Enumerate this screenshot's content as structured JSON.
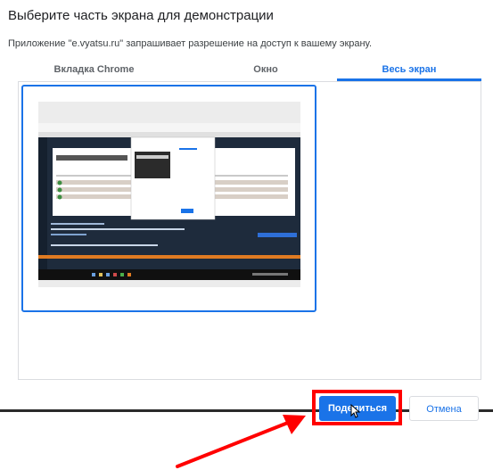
{
  "dialog": {
    "title": "Выберите часть экрана для демонстрации",
    "subtitle": "Приложение \"e.vyatsu.ru\" запрашивает разрешение на доступ к вашему экрану."
  },
  "tabs": [
    {
      "label": "Вкладка Chrome",
      "active": false
    },
    {
      "label": "Окно",
      "active": false
    },
    {
      "label": "Весь экран",
      "active": true
    }
  ],
  "buttons": {
    "share_label": "Поделиться",
    "cancel_label": "Отмена"
  },
  "colors": {
    "accent": "#1a73e8",
    "annotation": "#ff0000"
  }
}
